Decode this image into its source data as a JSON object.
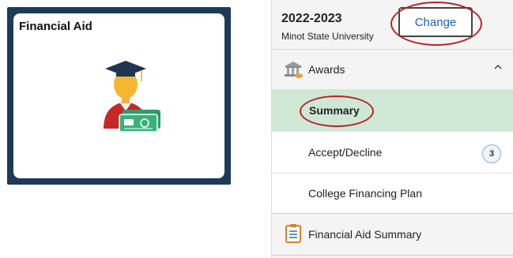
{
  "tile": {
    "title": "Financial Aid",
    "icon": "graduate-with-money-icon",
    "frame_color": "#1c3a5a"
  },
  "term": {
    "year": "2022-2023",
    "school": "Minot State University",
    "change_label": "Change"
  },
  "menu": {
    "awards": {
      "label": "Awards",
      "icon": "bank-icon"
    },
    "summary": {
      "label": "Summary"
    },
    "accept_decline": {
      "label": "Accept/Decline",
      "badge": "3"
    },
    "cfp": {
      "label": "College Financing Plan"
    },
    "fa_summary": {
      "label": "Financial Aid Summary",
      "icon": "clipboard-icon"
    }
  },
  "colors": {
    "selected_row": "#cfe8d6",
    "link_blue": "#1a62b5",
    "highlight_ring": "#b8232a"
  }
}
